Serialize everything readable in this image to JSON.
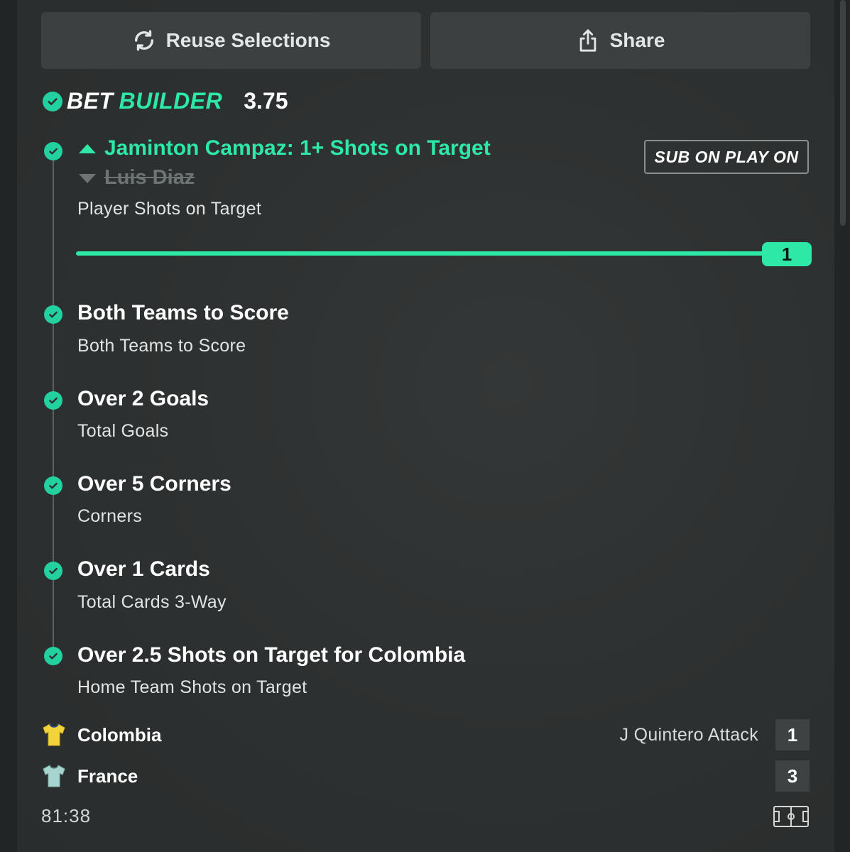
{
  "actions": {
    "reuse_label": "Reuse Selections",
    "share_label": "Share"
  },
  "bet_builder": {
    "title_word1": "BET",
    "title_word2": "BUILDER",
    "odds": "3.75"
  },
  "legs": [
    {
      "title": "Jaminton Campaz: 1+ Shots on Target",
      "substituted_out": "Luis Diaz",
      "badge": "SUB ON PLAY ON",
      "market": "Player Shots on Target",
      "slider_value": "1"
    },
    {
      "title": "Both Teams to Score",
      "market": "Both Teams to Score"
    },
    {
      "title": "Over 2 Goals",
      "market": "Total Goals"
    },
    {
      "title": "Over 5 Corners",
      "market": "Corners"
    },
    {
      "title": "Over 1 Cards",
      "market": "Total Cards 3-Way"
    },
    {
      "title": "Over 2.5 Shots on Target for Colombia",
      "market": "Home Team Shots on Target"
    }
  ],
  "match": {
    "home": {
      "name": "Colombia",
      "score": "1",
      "status": "J Quintero Attack",
      "shirt_color": "#f2d43a"
    },
    "away": {
      "name": "France",
      "score": "3",
      "shirt_color": "#a8d4cf"
    },
    "clock": "81:38"
  },
  "colors": {
    "accent": "#2ee8a8",
    "check": "#23d0a0",
    "background": "#2b2e2e",
    "button": "#3c4040"
  },
  "icons": [
    "refresh-icon",
    "share-icon",
    "check-circle-icon",
    "chevron-up-icon",
    "chevron-down-icon",
    "shirt-icon",
    "pitch-icon"
  ]
}
